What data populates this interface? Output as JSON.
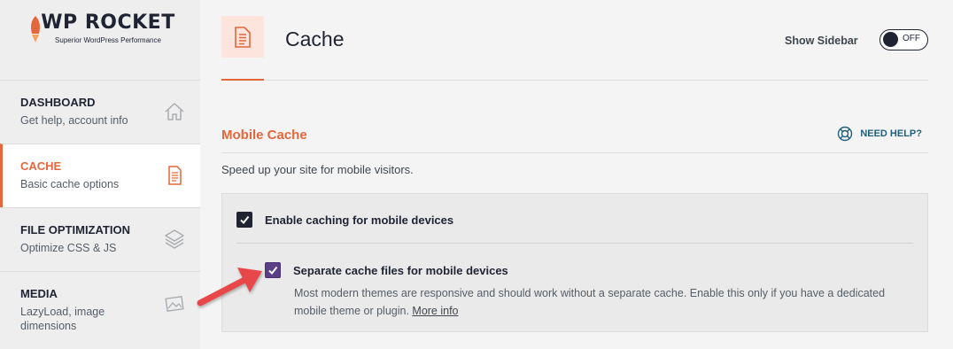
{
  "logo": {
    "title": "WP ROCKET",
    "tagline": "Superior WordPress Performance"
  },
  "sidebar": {
    "items": [
      {
        "title": "DASHBOARD",
        "desc": "Get help, account info",
        "icon": "home-icon"
      },
      {
        "title": "CACHE",
        "desc": "Basic cache options",
        "icon": "document-icon",
        "active": true
      },
      {
        "title": "FILE OPTIMIZATION",
        "desc": "Optimize CSS & JS",
        "icon": "layers-icon"
      },
      {
        "title": "MEDIA",
        "desc": "LazyLoad, image dimensions",
        "icon": "image-icon"
      }
    ]
  },
  "header": {
    "title": "Cache",
    "show_sidebar_label": "Show Sidebar",
    "toggle_state": "OFF"
  },
  "section": {
    "title": "Mobile Cache",
    "help_label": "NEED HELP?",
    "description": "Speed up your site for mobile visitors."
  },
  "options": {
    "enable_mobile": {
      "label": "Enable caching for mobile devices",
      "checked": true
    },
    "separate_files": {
      "label": "Separate cache files for mobile devices",
      "checked": true,
      "description": "Most modern themes are responsive and should work without a separate cache. Enable this only if you have a dedicated mobile theme or plugin. ",
      "link": "More info"
    }
  },
  "colors": {
    "accent": "#e4663b",
    "dark": "#1f2332",
    "checkbox_purple": "#5b3f86",
    "arrow": "#e8474a"
  }
}
